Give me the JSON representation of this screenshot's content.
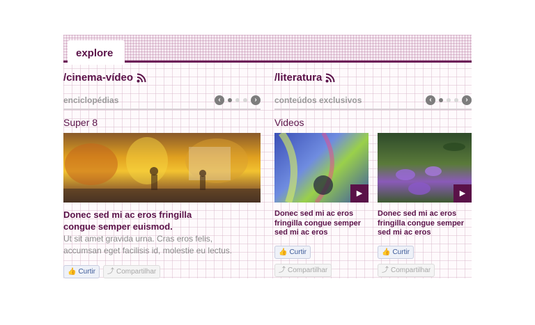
{
  "tab": {
    "label": "explore"
  },
  "left": {
    "section_title": "/cinema-vídeo",
    "subbar_label": "enciclopédias",
    "category": "Super 8",
    "headline_line1": "Donec sed mi ac eros fringilla",
    "headline_line2": "congue semper euismod.",
    "body_line1": "Ut sit amet gravida urna. Cras eros felis,",
    "body_line2": "accumsan eget facilisis id, molestie eu lectus.",
    "like_label": "Curtir",
    "share_label": "Compartilhar"
  },
  "right": {
    "section_title": "/literatura",
    "subbar_label": "conteúdos exclusivos",
    "category": "Videos",
    "items": [
      {
        "headline_line1": "Donec sed mi ac eros",
        "headline_line2": "fringilla congue semper",
        "headline_line3": "sed mi ac eros",
        "like_label": "Curtir",
        "share_label": "Compartilhar"
      },
      {
        "headline_line1": "Donec sed mi ac eros",
        "headline_line2": "fringilla congue semper",
        "headline_line3": "sed mi ac eros",
        "like_label": "Curtir",
        "share_label": "Compartilhar"
      }
    ]
  },
  "icons": {
    "rss": "rss-icon",
    "prev": "chevron-left-icon",
    "next": "chevron-right-icon",
    "play": "play-icon",
    "like": "thumbs-up-icon",
    "share": "share-icon"
  },
  "colors": {
    "accent": "#5a1148",
    "header_rule": "#6b1c57",
    "muted_text": "#8a8a8a",
    "facebook_blue": "#3b5998"
  }
}
